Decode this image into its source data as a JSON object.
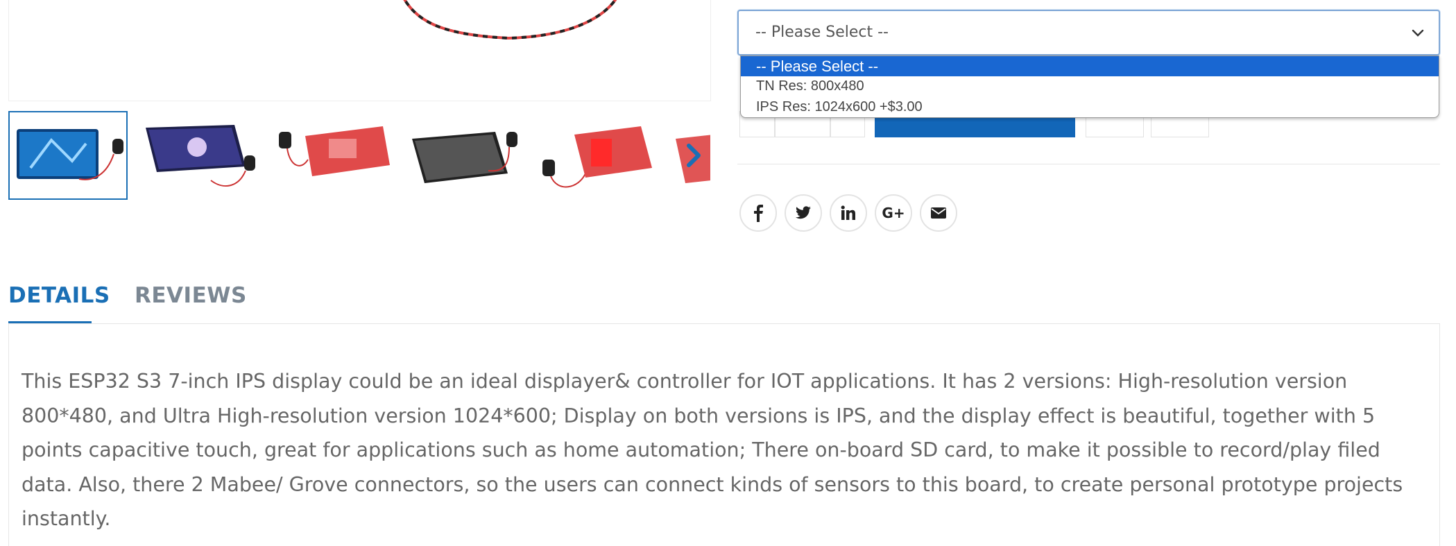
{
  "select": {
    "current_value": "-- Please Select --",
    "options": [
      "-- Please Select --",
      "TN Res: 800x480",
      "IPS Res: 1024x600 +$3.00"
    ]
  },
  "share": {
    "icons": [
      "facebook-icon",
      "twitter-icon",
      "linkedin-icon",
      "google-plus-icon",
      "email-icon"
    ],
    "google_label": "G+"
  },
  "tabs": {
    "details": "DETAILS",
    "reviews": "REVIEWS"
  },
  "details": {
    "text": "This ESP32 S3 7-inch IPS display could be an ideal displayer& controller for IOT applications. It has 2 versions: High-resolution version 800*480, and Ultra High-resolution version 1024*600; Display on both versions is IPS, and the display effect is beautiful, together with 5 points capacitive touch, great for applications such as home automation; There on-board SD card, to make it possible to record/play filed data. Also, there 2 Mabee/ Grove connectors, so the users can connect kinds of sensors to this board, to create personal prototype projects instantly."
  },
  "colors": {
    "accent": "#1a6fb5",
    "dropdown_highlight": "#1967d2",
    "tab_inactive": "#7b8793",
    "body_text": "#666666"
  }
}
